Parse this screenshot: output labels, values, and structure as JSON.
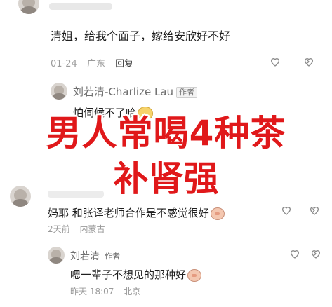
{
  "comments": [
    {
      "text": "清姐，给我个面子，嫁给安欣好不好",
      "date": "01-24",
      "location": "广东",
      "reply_label": "回复"
    },
    {
      "author": "刘若清-Charlize Lau",
      "author_tag": "作者",
      "text": "怕伺候不了哈"
    },
    {
      "text": "妈耶 和张译老师合作是不感觉很好",
      "date": "2天前",
      "location": "内蒙古"
    },
    {
      "author": "刘若清",
      "author_tag": "作者",
      "text": "嗯一辈子不想见的那种好",
      "date": "昨天 18:07",
      "location": "北京"
    }
  ],
  "overlay": {
    "line1": "男人常喝4种茶",
    "line2": "补肾强"
  },
  "colors": {
    "overlay_text": "#e0181a",
    "meta_text": "#9a9a9a"
  },
  "icons": [
    "heart-outline-icon",
    "dislike-icon",
    "sticker-face-icon"
  ]
}
